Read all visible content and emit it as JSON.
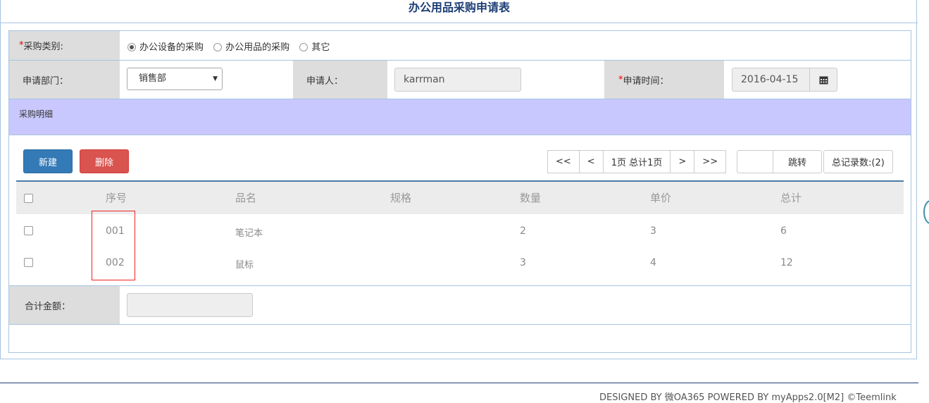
{
  "title": "办公用品采购申请表",
  "category": {
    "label": "采购类别:",
    "required_mark": "*",
    "options": [
      {
        "label": "办公设备的采购",
        "selected": true
      },
      {
        "label": "办公用品的采购",
        "selected": false
      },
      {
        "label": "其它",
        "selected": false
      }
    ]
  },
  "dept": {
    "label": "申请部门：",
    "value": "销售部"
  },
  "applicant": {
    "label": "申请人：",
    "value": "karrman"
  },
  "date": {
    "label": "申请时间：",
    "required_mark": "*",
    "value": "2016-04-15",
    "icon": "calendar-icon"
  },
  "detail_section": "采购明细",
  "toolbar": {
    "new_label": "新建",
    "delete_label": "删除"
  },
  "pager": {
    "first": "<<",
    "prev": "<",
    "info": "1页 总计1页",
    "next": ">",
    "last": ">>",
    "page_input": "",
    "jump_label": "跳转",
    "total_label": "总记录数:(2)"
  },
  "table": {
    "headers": [
      "序号",
      "品名",
      "规格",
      "数量",
      "单价",
      "总计"
    ],
    "rows": [
      {
        "no": "001",
        "name": "笔记本",
        "spec": "",
        "qty": "2",
        "price": "3",
        "total": "6"
      },
      {
        "no": "002",
        "name": "鼠标",
        "spec": "",
        "qty": "3",
        "price": "4",
        "total": "12"
      }
    ]
  },
  "sum": {
    "label": "合计金额：",
    "value": ""
  },
  "footer": "DESIGNED BY 微OA365 POWERED BY myApps2.0[M2] ©Teemlink",
  "colors": {
    "title": "#1c3f75",
    "section_bg": "#c8c8ff",
    "new_btn": "#337ab7",
    "delete_btn": "#d9534f",
    "highlight": "#ee2222"
  }
}
